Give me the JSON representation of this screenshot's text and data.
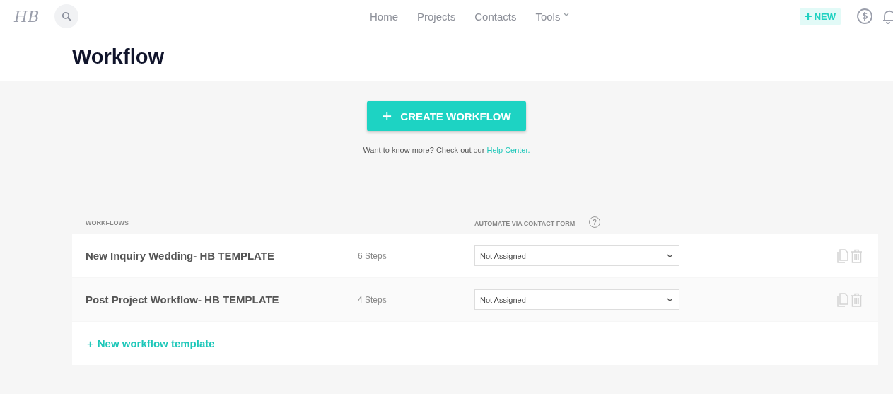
{
  "logo": "HB",
  "nav": [
    {
      "label": "Home",
      "dropdown": false
    },
    {
      "label": "Projects",
      "dropdown": false
    },
    {
      "label": "Contacts",
      "dropdown": false
    },
    {
      "label": "Tools",
      "dropdown": true
    }
  ],
  "new_button": {
    "icon": "+",
    "label": "NEW"
  },
  "page_title": "Workflow",
  "create_button": {
    "icon": "+",
    "label": "CREATE WORKFLOW"
  },
  "help": {
    "text": "Want to know more? Check out our ",
    "link": "Help Center."
  },
  "table": {
    "columns": [
      "WORKFLOWS",
      "AUTOMATE VIA CONTACT FORM"
    ],
    "help_icon": "?",
    "rows": [
      {
        "name": "New Inquiry Wedding- HB TEMPLATE",
        "steps": "6 Steps",
        "form": "Not Assigned"
      },
      {
        "name": "Post Project Workflow- HB TEMPLATE",
        "steps": "4 Steps",
        "form": "Not Assigned"
      }
    ],
    "add_link": {
      "icon": "+",
      "label": "New workflow template"
    }
  }
}
